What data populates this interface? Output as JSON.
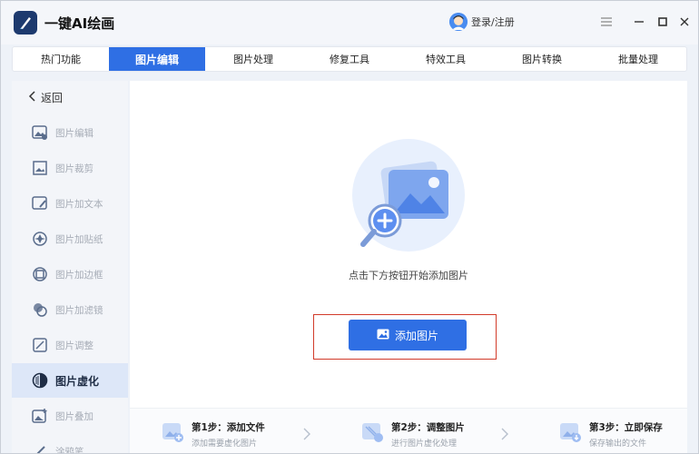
{
  "app": {
    "title": "一键AI绘画",
    "login_label": "登录/注册"
  },
  "tabs": [
    {
      "label": "热门功能",
      "active": false
    },
    {
      "label": "图片编辑",
      "active": true
    },
    {
      "label": "图片处理",
      "active": false
    },
    {
      "label": "修复工具",
      "active": false
    },
    {
      "label": "特效工具",
      "active": false
    },
    {
      "label": "图片转换",
      "active": false
    },
    {
      "label": "批量处理",
      "active": false
    }
  ],
  "sidebar": {
    "back_label": "返回",
    "items": [
      {
        "label": "图片编辑",
        "icon": "image-edit-icon"
      },
      {
        "label": "图片裁剪",
        "icon": "crop-icon"
      },
      {
        "label": "图片加文本",
        "icon": "text-icon"
      },
      {
        "label": "图片加贴纸",
        "icon": "sticker-icon"
      },
      {
        "label": "图片加边框",
        "icon": "frame-icon"
      },
      {
        "label": "图片加滤镜",
        "icon": "filter-icon"
      },
      {
        "label": "图片调整",
        "icon": "adjust-icon"
      },
      {
        "label": "图片虚化",
        "icon": "blur-icon",
        "active": true
      },
      {
        "label": "图片叠加",
        "icon": "overlay-icon"
      },
      {
        "label": "涂鸦笔",
        "icon": "brush-icon"
      }
    ]
  },
  "main": {
    "hint": "点击下方按钮开始添加图片",
    "add_button_label": "添加图片",
    "steps": [
      {
        "title": "第1步：添加文件",
        "desc": "添加需要虚化图片"
      },
      {
        "title": "第2步：调整图片",
        "desc": "进行图片虚化处理"
      },
      {
        "title": "第3步：立即保存",
        "desc": "保存输出的文件"
      }
    ]
  },
  "colors": {
    "accent": "#2f6fe4",
    "highlight": "#d23b2a"
  }
}
